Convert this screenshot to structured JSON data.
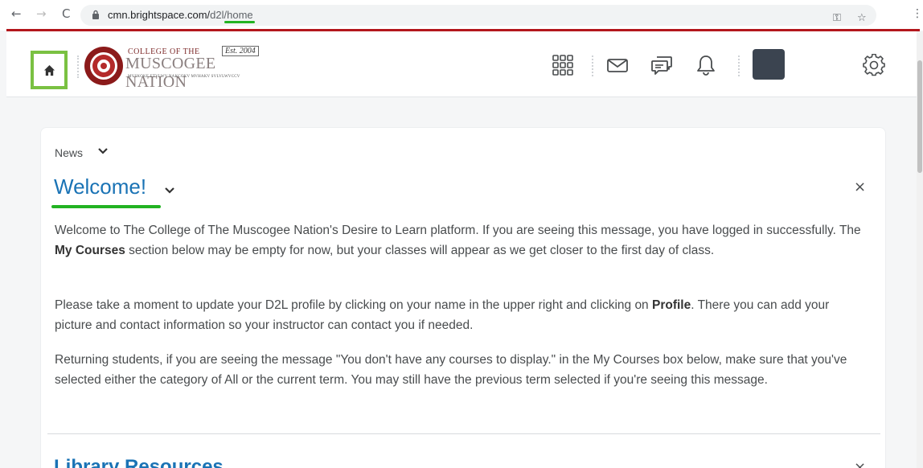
{
  "browser": {
    "back": "←",
    "forward": "→",
    "reload": "C",
    "url_host": "cmn.brightspace.com/",
    "url_path_a": "d2l/",
    "url_path_b": "home",
    "key_icon": "key-icon",
    "star_icon": "star-icon",
    "menu": "⋮"
  },
  "header": {
    "logo": {
      "line1": "COLLEGE OF THE",
      "est": "Est. 2004",
      "line2": "MUSCOGEE NATION",
      "line3": "MVSKOKE ETVLWV NAKCOKV MVHAKV SVLVLWVCCV"
    },
    "icons": [
      "home-icon",
      "waffle-icon",
      "mail-icon",
      "chat-icon",
      "bell-icon",
      "gear-icon"
    ],
    "accent_color": "#b3161c",
    "highlight_color": "#7ac142"
  },
  "news": {
    "section_label": "News",
    "title": "Welcome!",
    "close": "×",
    "p1_a": "Welcome to The College of The Muscogee Nation's Desire to Learn platform. If you are seeing this message, you have logged in successfully. The ",
    "p1_b": "My Courses",
    "p1_c": " section below may be empty for now, but your classes will appear as we get closer to the first day of class.",
    "p2_a": "Please take a moment to update your D2L profile by clicking on your name in the upper right and clicking on ",
    "p2_b": "Profile",
    "p2_c": ". There you can add your picture and contact information so your instructor can contact you if needed.",
    "p3": "Returning students, if you are seeing the message \"You don't have any courses to display.\" in the My Courses box below, make sure that you've selected either the category of All or the current term. You may still have the previous term selected if you're seeing this message."
  },
  "library": {
    "title": "Library Resources",
    "close": "×"
  }
}
